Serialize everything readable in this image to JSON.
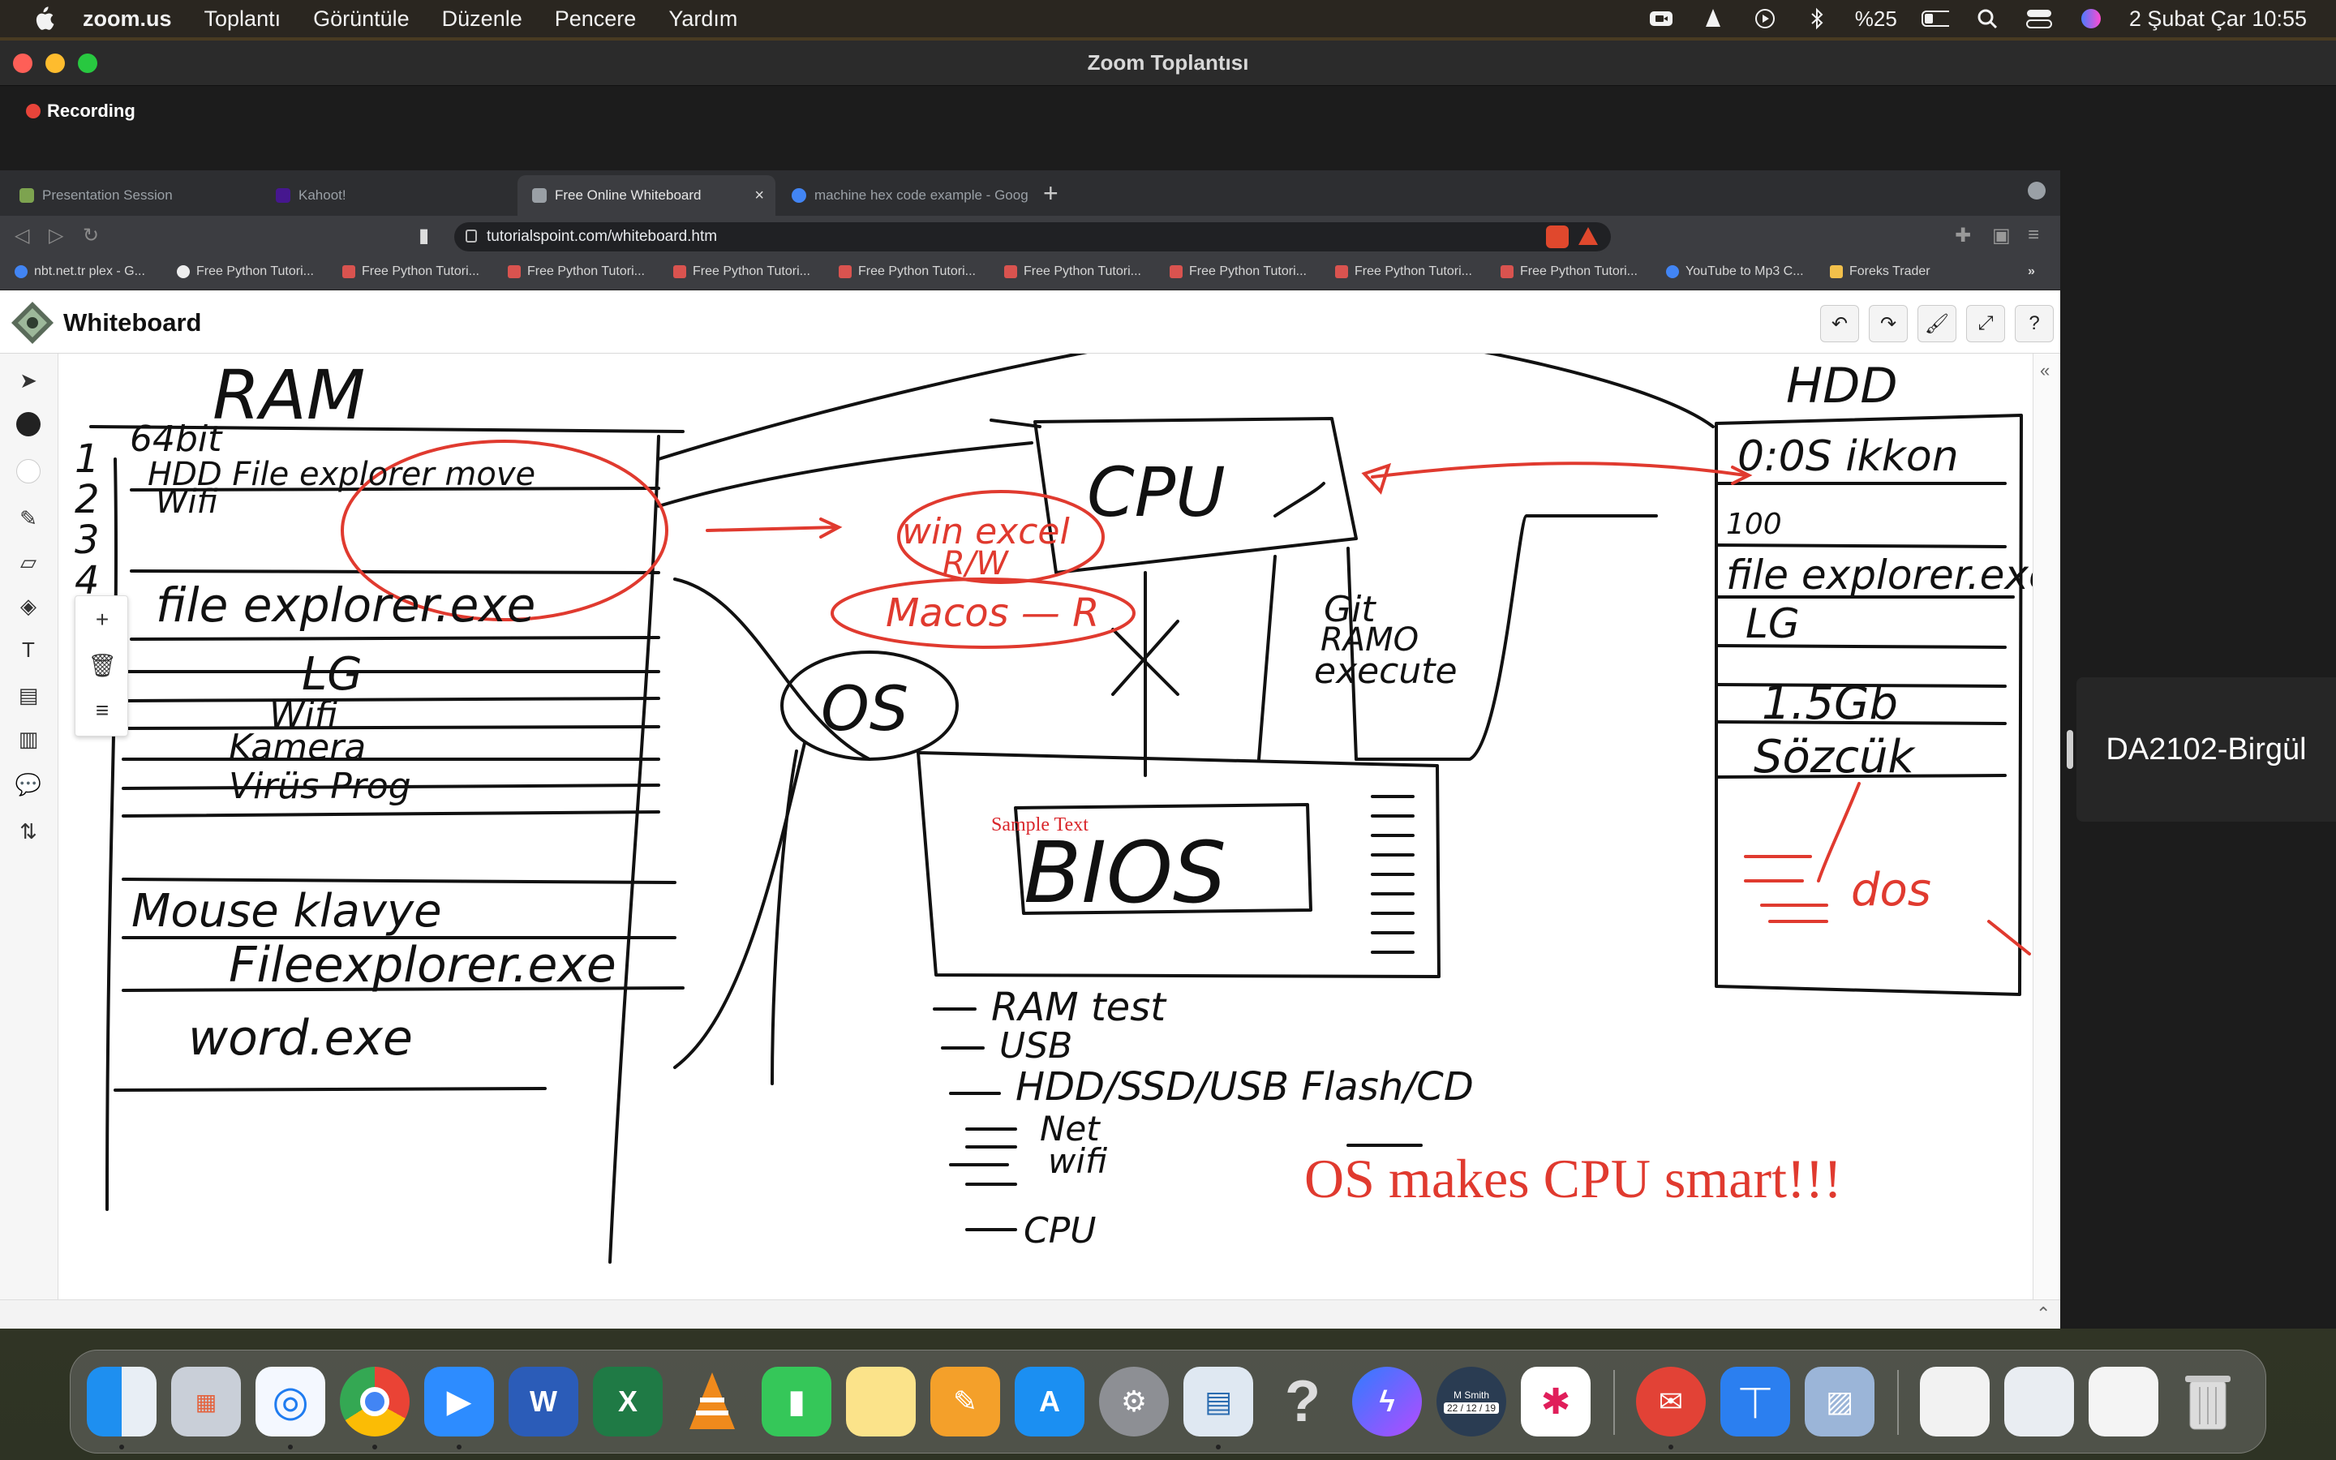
{
  "menubar": {
    "app_name": "zoom.us",
    "menus": [
      "Toplantı",
      "Görüntüle",
      "Düzenle",
      "Pencere",
      "Yardım"
    ],
    "battery": "%25",
    "datetime": "2 Şubat Çar  10:55"
  },
  "zoom": {
    "title": "Zoom Toplantısı",
    "recording": "Recording",
    "participant": "DA2102-Birgül"
  },
  "browser": {
    "tabs": [
      {
        "label": "Presentation Session"
      },
      {
        "label": "Kahoot!"
      },
      {
        "label": "Free Online Whiteboard"
      },
      {
        "label": "machine hex code example - Goog"
      }
    ],
    "url": "tutorialspoint.com/whiteboard.htm",
    "bookmarks": [
      "nbt.net.tr plex - G...",
      "Free Python Tutori...",
      "Free Python Tutori...",
      "Free Python Tutori...",
      "Free Python Tutori...",
      "Free Python Tutori...",
      "Free Python Tutori...",
      "Free Python Tutori...",
      "Free Python Tutori...",
      "Free Python Tutori...",
      "YouTube to Mp3 C...",
      "Foreks Trader"
    ]
  },
  "whiteboard": {
    "title": "Whiteboard",
    "handwriting": {
      "ram": "RAM",
      "bit": "64bit",
      "hdd_explorer": "HDD File explorer move",
      "wifi": "Wifi",
      "file_explorer": "file explorer.exe",
      "lg": "LG",
      "wifi2": "Wifi",
      "kamera": "Kamera",
      "virus": "Virüs Prog",
      "mouse": "Mouse klavye",
      "fileexplorer2": "Fileexplorer.exe",
      "word": "word.exe",
      "cpu": "CPU",
      "win_excel": "win excel",
      "rw": "R/W",
      "macos": "Macos — R",
      "os": "OS",
      "git": "Git",
      "ramo": "RAMO",
      "execute": "execute",
      "hdd": "HDD",
      "os_ikkon": "0:0S ikkon",
      "hundred": "100",
      "fileexplorer_hdd": "file explorer.exe",
      "lg2": "LG",
      "gb": "1.5Gb",
      "sozcuk": "Sözcük",
      "dos": "dos",
      "bios": "BIOS",
      "ram_test": "RAM test",
      "usb": "USB",
      "hdd_ssd": "HDD/SSD/USB Flash/CD",
      "net": "Net",
      "wifi3": "wifi",
      "cpu2": "CPU",
      "num1": "1",
      "num2": "2",
      "num3": "3",
      "num4": "4"
    },
    "sample_text": "Sample Text",
    "slogan": "OS makes CPU smart!!!"
  },
  "dock": {
    "calendar_name": "M Smith",
    "calendar_date": "22 / 12 / 19"
  },
  "colors": {
    "ink_black": "#111111",
    "ink_red": "#e03a2f",
    "menubar_bg": "#2a2620"
  }
}
